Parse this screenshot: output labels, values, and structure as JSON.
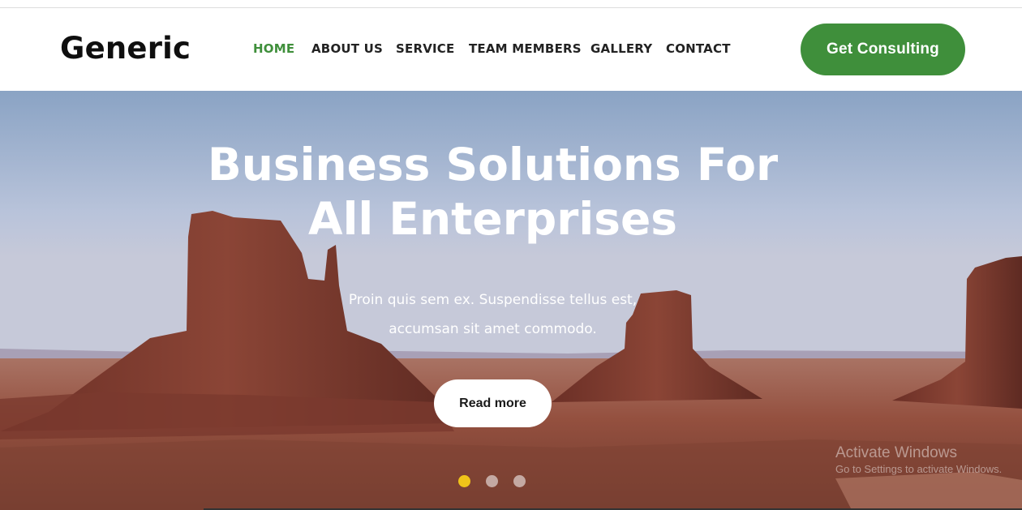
{
  "header": {
    "logo": "Generic",
    "nav": [
      {
        "label": "HOME",
        "active": true
      },
      {
        "label": "ABOUT US",
        "active": false
      },
      {
        "label": "SERVICE",
        "active": false
      },
      {
        "label": "TEAM MEMBERS",
        "active": false
      },
      {
        "label": "GALLERY",
        "active": false
      },
      {
        "label": "CONTACT",
        "active": false
      }
    ],
    "cta_label": "Get Consulting"
  },
  "hero": {
    "title_line1": "Business Solutions For",
    "title_line2": "All Enterprises",
    "subtitle_line1": "Proin quis sem ex. Suspendisse tellus est,",
    "subtitle_line2": "accumsan sit amet commodo.",
    "button_label": "Read more",
    "slides": 3,
    "active_slide": 1
  },
  "watermark": {
    "title": "Activate Windows",
    "subtitle": "Go to Settings to activate Windows."
  },
  "colors": {
    "accent": "#3f8f3b",
    "active_dot": "#f0c419",
    "text_dark": "#222222"
  }
}
